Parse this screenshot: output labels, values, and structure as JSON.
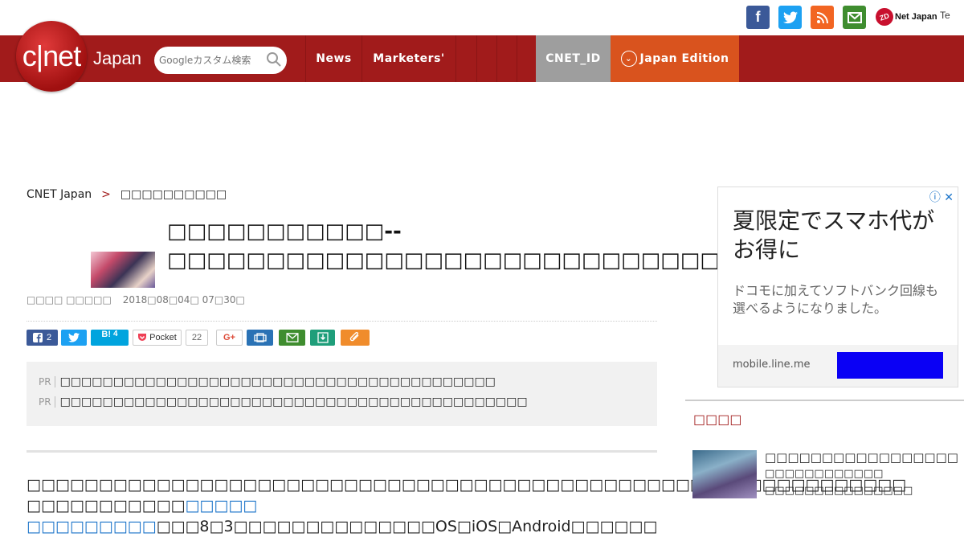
{
  "header": {
    "social": {
      "facebook": "f",
      "twitter": "t",
      "rss": "rss",
      "mail": "mail"
    },
    "zd_logo_mark": "ZD",
    "zd_logo_text": "Net Japan",
    "te_logo_text": "Te"
  },
  "nav": {
    "logo_text": "c|net",
    "logo_sub": "Japan",
    "search_placeholder": "Googleカスタム検索",
    "items": [
      {
        "label": "News"
      },
      {
        "label": "Marketers'"
      }
    ],
    "cnet_id": "CNET_ID",
    "edition": "Japan Edition"
  },
  "article": {
    "breadcrumb_home": "CNET Japan",
    "breadcrumb_sep": ">",
    "breadcrumb_current": "□□□□□□□□□□",
    "title": "□□□□□□□□□□□--□□□□□□□□□□□□□□□□□□□□□□□□□□□□□□□□□□",
    "author": "□□□□ □□□□□",
    "date": "2018□08□04□ 07□30□",
    "share": {
      "fb_count": "2",
      "hatena_label": "B!",
      "hatena_count": "4",
      "pocket_label": "Pocket",
      "pocket_count": "22",
      "gplus_label": "G+"
    },
    "pr": [
      {
        "tag": "PR",
        "text": "□□□□□□□□□□□□□□□□□□□□□□□□□□□□□□□□□□□□□□□□□"
      },
      {
        "tag": "PR",
        "text": "□□□□□□□□□□□□□□□□□□□□□□□□□□□□□□□□□□□□□□□□□□□□"
      }
    ],
    "body_line1": "□□□□□□□□□□□□□□□□□□□□□□□□□□□□□□□□□□□□□□□□□□□□□□□□□□□□□□□□□□□□□",
    "body_line2_pre": "□□□□□□□□□□□",
    "body_link": "□□□□□ □□□□□□□□□",
    "body_line2_post": "□□□8□3□□□□□□□□□□□□□□OS□iOS□Android□□□□□□"
  },
  "ad": {
    "headline": "夏限定でスマホ代がお得に",
    "sub": "ドコモに加えてソフトバンク回線も選べるようになりました。",
    "url": "mobile.line.me",
    "close": "ⓘ ✕",
    "button_color": "#0a00f5"
  },
  "sidebar": {
    "title": "□□□□",
    "items": [
      {
        "line1": "□□□□□□□□□□□□□□□□□",
        "line2": "□□□□□□□□□□□□",
        "line3": "□□□□□□□□□□□□□□□"
      }
    ]
  },
  "colors": {
    "brand_red": "#a11b1b",
    "edition_orange": "#d9531e",
    "cnetid_gray": "#9e9e9e",
    "link_blue": "#1a73c9"
  }
}
